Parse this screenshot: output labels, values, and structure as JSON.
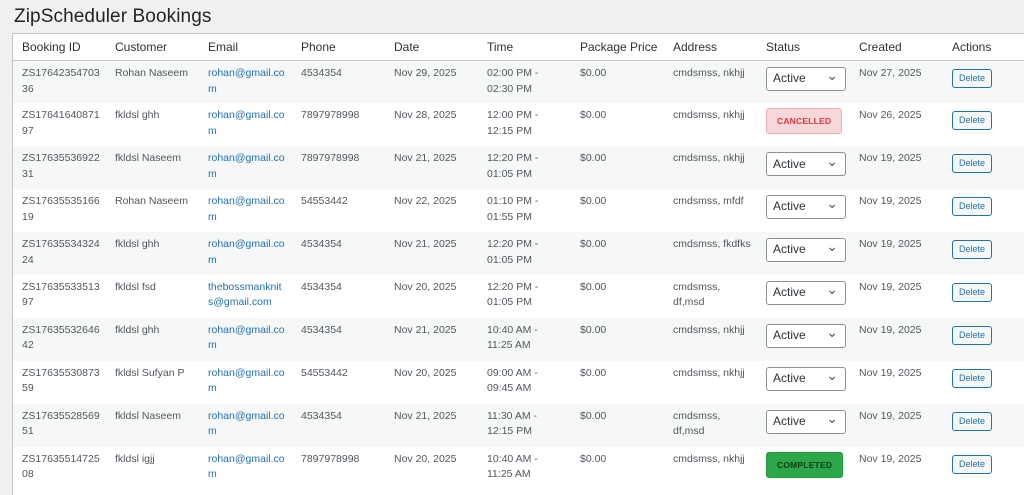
{
  "page_title": "ZipScheduler Bookings",
  "columns": [
    "Booking ID",
    "Customer",
    "Email",
    "Phone",
    "Date",
    "Time",
    "Package Price",
    "Address",
    "Status",
    "Created",
    "Actions"
  ],
  "rows": [
    {
      "id": "ZS1764235470336",
      "customer": "Rohan Naseem",
      "email": "rohan@gmail.com",
      "phone": "4534354",
      "date": "Nov 29, 2025",
      "time": "02:00 PM - 02:30 PM",
      "price": "$0.00",
      "address": "cmdsmss, nkhjj",
      "status_type": "select",
      "status": "Active",
      "created": "Nov 27, 2025",
      "action": "Delete"
    },
    {
      "id": "ZS1764164087197",
      "customer": "fkldsl ghh",
      "email": "rohan@gmail.com",
      "phone": "7897978998",
      "date": "Nov 28, 2025",
      "time": "12:00 PM - 12:15 PM",
      "price": "$0.00",
      "address": "cmdsmss, nkhjj",
      "status_type": "badge-cancelled",
      "status": "CANCELLED",
      "created": "Nov 26, 2025",
      "action": "Delete"
    },
    {
      "id": "ZS1763553692231",
      "customer": "fkldsl Naseem",
      "email": "rohan@gmail.com",
      "phone": "7897978998",
      "date": "Nov 21, 2025",
      "time": "12:20 PM - 01:05 PM",
      "price": "$0.00",
      "address": "cmdsmss, nkhjj",
      "status_type": "select",
      "status": "Active",
      "created": "Nov 19, 2025",
      "action": "Delete"
    },
    {
      "id": "ZS1763553516619",
      "customer": "Rohan Naseem",
      "email": "rohan@gmail.com",
      "phone": "54553442",
      "date": "Nov 22, 2025",
      "time": "01:10 PM - 01:55 PM",
      "price": "$0.00",
      "address": "cmdsmss, mfdf",
      "status_type": "select",
      "status": "Active",
      "created": "Nov 19, 2025",
      "action": "Delete"
    },
    {
      "id": "ZS1763553432424",
      "customer": "fkldsl ghh",
      "email": "rohan@gmail.com",
      "phone": "4534354",
      "date": "Nov 21, 2025",
      "time": "12:20 PM - 01:05 PM",
      "price": "$0.00",
      "address": "cmdsmss, fkdfks",
      "status_type": "select",
      "status": "Active",
      "created": "Nov 19, 2025",
      "action": "Delete"
    },
    {
      "id": "ZS1763553351397",
      "customer": "fkldsl fsd",
      "email": "thebossmanknits@gmail.com",
      "phone": "4534354",
      "date": "Nov 20, 2025",
      "time": "12:20 PM - 01:05 PM",
      "price": "$0.00",
      "address": "cmdsmss, df,msd",
      "status_type": "select",
      "status": "Active",
      "created": "Nov 19, 2025",
      "action": "Delete"
    },
    {
      "id": "ZS1763553264642",
      "customer": "fkldsl ghh",
      "email": "rohan@gmail.com",
      "phone": "4534354",
      "date": "Nov 21, 2025",
      "time": "10:40 AM - 11:25 AM",
      "price": "$0.00",
      "address": "cmdsmss, nkhjj",
      "status_type": "select",
      "status": "Active",
      "created": "Nov 19, 2025",
      "action": "Delete"
    },
    {
      "id": "ZS1763553087359",
      "customer": "fkldsl Sufyan P",
      "email": "rohan@gmail.com",
      "phone": "54553442",
      "date": "Nov 20, 2025",
      "time": "09:00 AM - 09:45 AM",
      "price": "$0.00",
      "address": "cmdsmss, nkhjj",
      "status_type": "select",
      "status": "Active",
      "created": "Nov 19, 2025",
      "action": "Delete"
    },
    {
      "id": "ZS1763552856951",
      "customer": "fkldsl Naseem",
      "email": "rohan@gmail.com",
      "phone": "4534354",
      "date": "Nov 21, 2025",
      "time": "11:30 AM - 12:15 PM",
      "price": "$0.00",
      "address": "cmdsmss, df,msd",
      "status_type": "select",
      "status": "Active",
      "created": "Nov 19, 2025",
      "action": "Delete"
    },
    {
      "id": "ZS1763551472508",
      "customer": "fkldsl igjj",
      "email": "rohan@gmail.com",
      "phone": "7897978998",
      "date": "Nov 20, 2025",
      "time": "10:40 AM - 11:25 AM",
      "price": "$0.00",
      "address": "cmdsmss, nkhjj",
      "status_type": "badge-completed",
      "status": "COMPLETED",
      "created": "Nov 19, 2025",
      "action": "Delete"
    }
  ]
}
